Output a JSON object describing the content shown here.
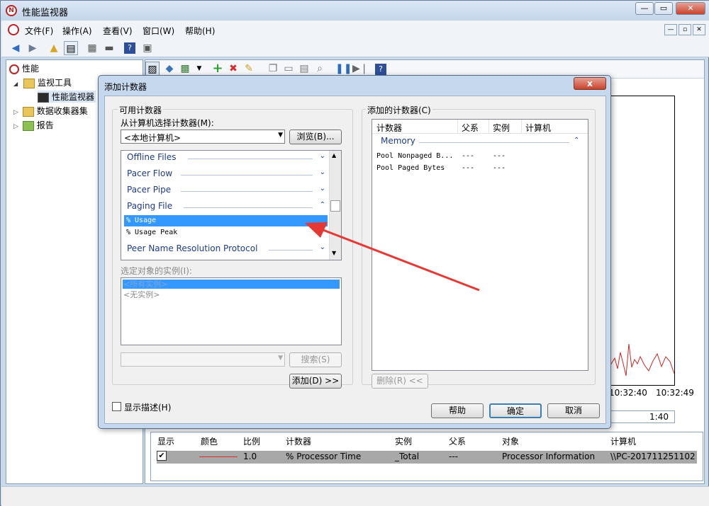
{
  "window": {
    "title": "性能监视器",
    "caption_buttons": [
      "—",
      "▭",
      "✕"
    ]
  },
  "menu": [
    "文件(F)",
    "操作(A)",
    "查看(V)",
    "窗口(W)",
    "帮助(H)"
  ],
  "tree": {
    "root": "性能",
    "items": [
      {
        "label": "监视工具",
        "level": 1
      },
      {
        "label": "性能监视器",
        "level": 2
      },
      {
        "label": "数据收集器集",
        "level": 1
      },
      {
        "label": "报告",
        "level": 1
      }
    ]
  },
  "graph": {
    "xticks": [
      "10:32:40",
      "10:32:49"
    ],
    "duration": "1:40"
  },
  "counters_table": {
    "headers": [
      "显示",
      "颜色",
      "比例",
      "计数器",
      "实例",
      "父系",
      "对象",
      "计算机"
    ],
    "row": {
      "show": "✔",
      "scale": "1.0",
      "counter": "% Processor Time",
      "instance": "_Total",
      "parent": "---",
      "object": "Processor Information",
      "computer": "\\\\PC-201711251102"
    },
    "line_color": "#d32f2f"
  },
  "dialog": {
    "title": "添加计数器",
    "close_label": "x",
    "available_label": "可用计数器",
    "select_from_label": "从计算机选择计数器(M):",
    "computer_combo": "<本地计算机>",
    "browse_button": "浏览(B)...",
    "categories": [
      {
        "label": "Offline Files",
        "state": "collapsed"
      },
      {
        "label": "Pacer Flow",
        "state": "collapsed"
      },
      {
        "label": "Pacer Pipe",
        "state": "collapsed"
      },
      {
        "label": "Paging File",
        "state": "expanded"
      }
    ],
    "paging_counters": [
      "% Usage",
      "% Usage Peak"
    ],
    "category_after": {
      "label": "Peer Name Resolution Protocol",
      "state": "collapsed"
    },
    "instances_label": "选定对象的实例(I):",
    "instances": [
      "<所有实例>",
      "<无实例>"
    ],
    "search_button": "搜索(S)",
    "add_button": "添加(D) >>",
    "added_label": "添加的计数器(C)",
    "added_headers": [
      "计数器",
      "父系",
      "实例",
      "计算机"
    ],
    "added_group": "Memory",
    "added_rows": [
      {
        "counter": "Pool Nonpaged B...",
        "parent": "---",
        "instance": "---"
      },
      {
        "counter": "Pool Paged Bytes",
        "parent": "---",
        "instance": "---"
      }
    ],
    "remove_button": "删除(R) <<",
    "show_desc_label": "显示描述(H)",
    "help_button": "帮助",
    "ok_button": "确定",
    "cancel_button": "取消"
  },
  "colors": {
    "selection": "#3399ff",
    "annotation_arrow": "#e53935"
  }
}
